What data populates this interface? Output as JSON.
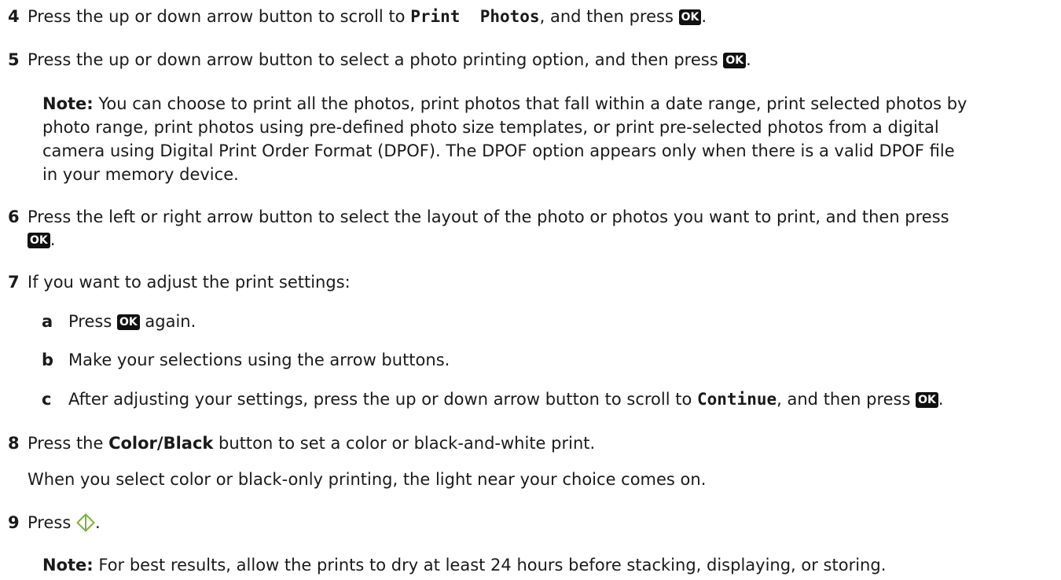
{
  "steps": {
    "s4": {
      "num": "4",
      "pre": "Press the up or down arrow button to scroll to ",
      "code": "Print  Photos",
      "post": ", and then press ",
      "end": "."
    },
    "s5": {
      "num": "5",
      "pre": "Press the up or down arrow button to select a photo printing option, and then press ",
      "end": "."
    },
    "note1": {
      "label": "Note:",
      "line1": " You can choose to print all the photos, print photos that fall within a date range, print selected photos by",
      "line2": "photo range, print photos using pre-defined photo size templates, or print pre-selected photos from a digital",
      "line3": "camera using Digital Print Order Format (DPOF). The DPOF option appears only when there is a valid DPOF file",
      "line4": "in your memory device."
    },
    "s6": {
      "num": "6",
      "line1": "Press the left or right arrow button to select the layout of the photo or photos you want to print, and then press",
      "end": "."
    },
    "s7": {
      "num": "7",
      "text": "If you want to adjust the print settings:",
      "a_letter": "a",
      "a_pre": "Press ",
      "a_post": " again.",
      "b_letter": "b",
      "b_text": "Make your selections using the arrow buttons.",
      "c_letter": "c",
      "c_pre": "After adjusting your settings, press the up or down arrow button to scroll to ",
      "c_code": "Continue",
      "c_post": ", and then press ",
      "c_end": "."
    },
    "s8": {
      "num": "8",
      "pre": "Press the ",
      "bold": "Color/Black",
      "post": " button to set a color or black-and-white print.",
      "line2": "When you select color or black-only printing, the light near your choice comes on."
    },
    "s9": {
      "num": "9",
      "pre": "Press ",
      "end": "."
    },
    "note2": {
      "label": "Note:",
      "text": " For best results, allow the prints to dry at least 24 hours before stacking, displaying, or storing."
    }
  },
  "icons": {
    "ok_label": "OK",
    "start_icon": "start-button-icon",
    "start_color": "#7ab23a"
  }
}
